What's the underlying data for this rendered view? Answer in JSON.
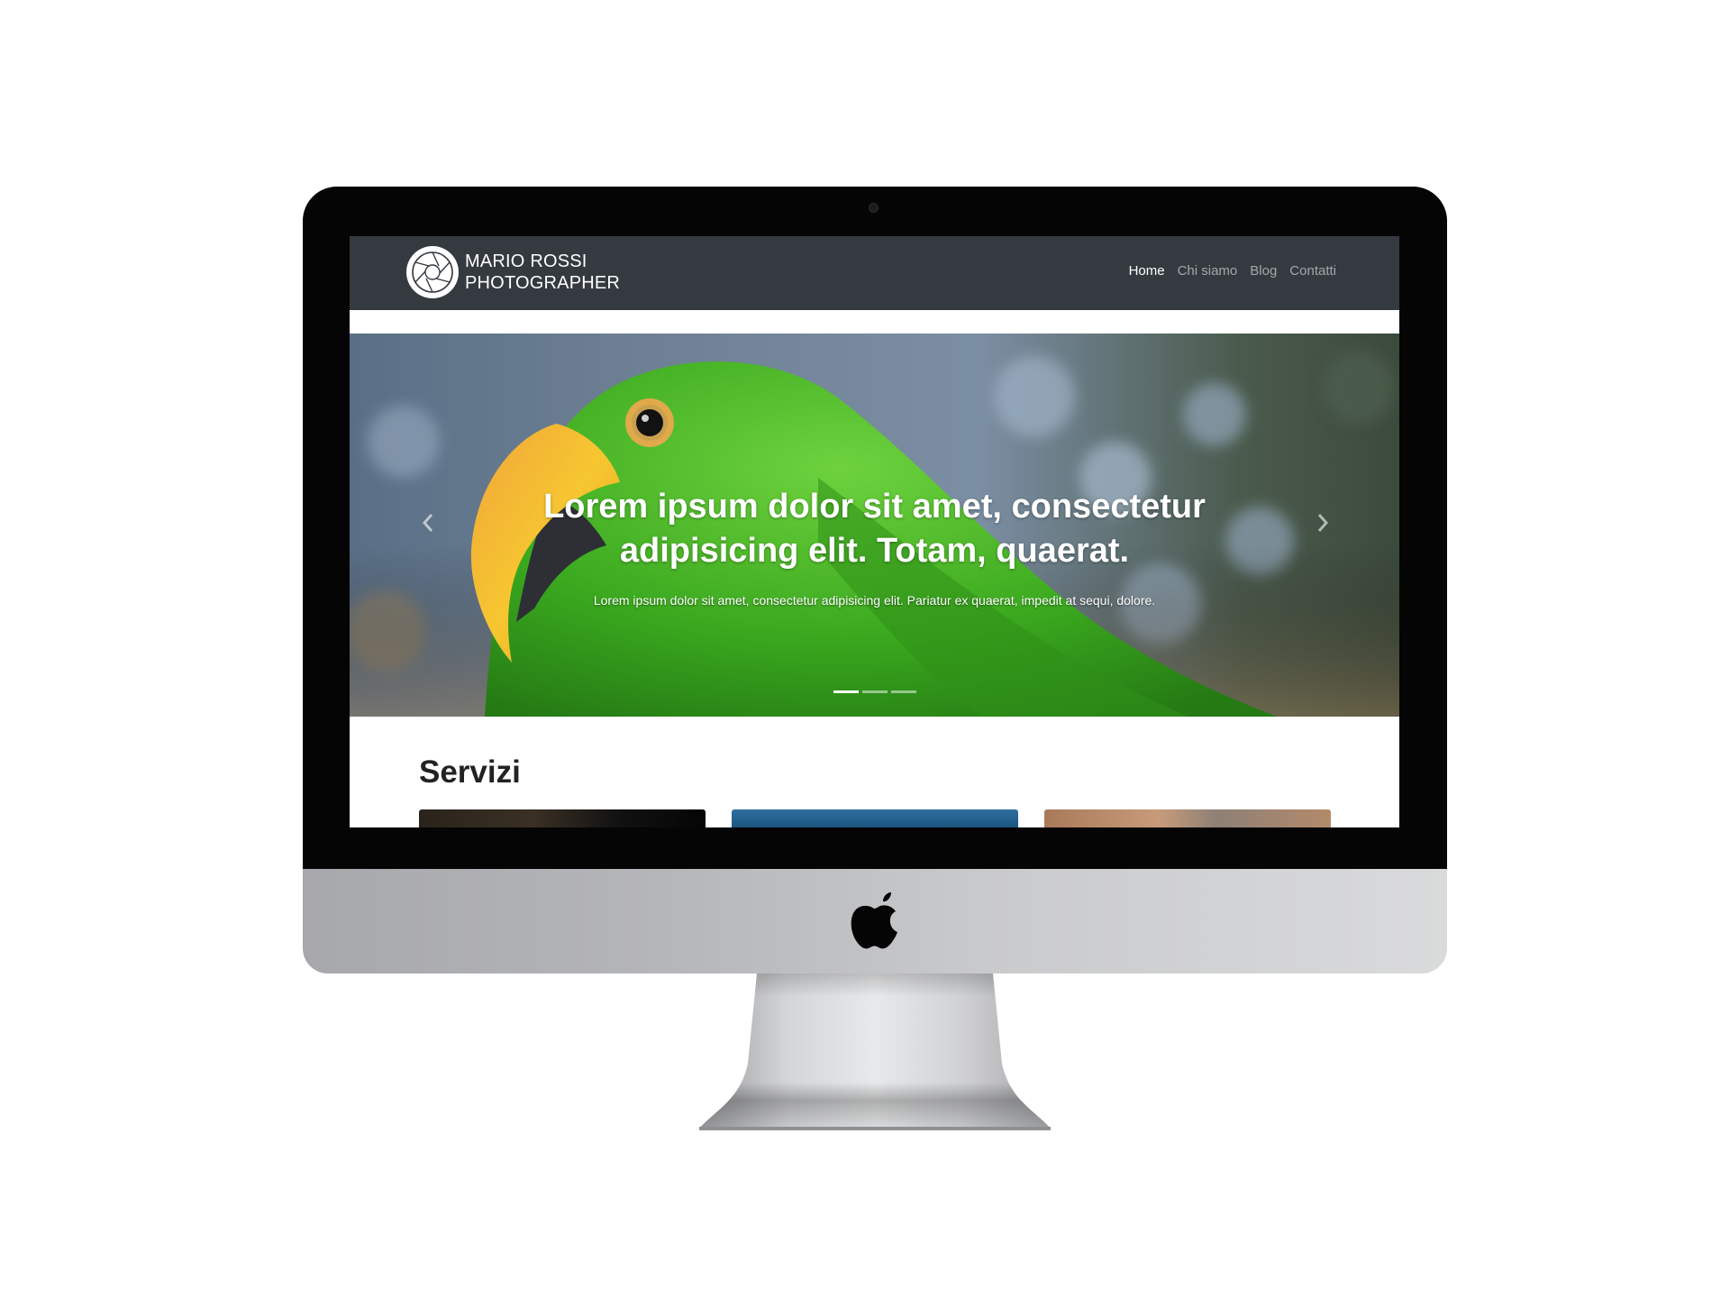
{
  "brand": {
    "line1": "MARIO ROSSI",
    "line2": "PHOTOGRAPHER"
  },
  "nav": {
    "items": [
      {
        "label": "Home",
        "active": true
      },
      {
        "label": "Chi siamo",
        "active": false
      },
      {
        "label": "Blog",
        "active": false
      },
      {
        "label": "Contatti",
        "active": false
      }
    ]
  },
  "hero": {
    "title": "Lorem ipsum dolor sit amet, consectetur adipisicing elit. Totam, quaerat.",
    "subtitle": "Lorem ipsum dolor sit amet, consectetur adipisicing elit. Pariatur ex quaerat, impedit at sequi, dolore.",
    "active_slide": 1,
    "slide_count": 3
  },
  "services": {
    "title": "Servizi"
  },
  "icons": {
    "brand_logo": "camera-aperture-icon",
    "prev": "chevron-left-icon",
    "next": "chevron-right-icon",
    "device_logo": "apple-logo-icon"
  },
  "colors": {
    "navbar": "#343a40",
    "nav_active": "#ffffff",
    "nav_inactive": "rgba(255,255,255,0.55)"
  }
}
